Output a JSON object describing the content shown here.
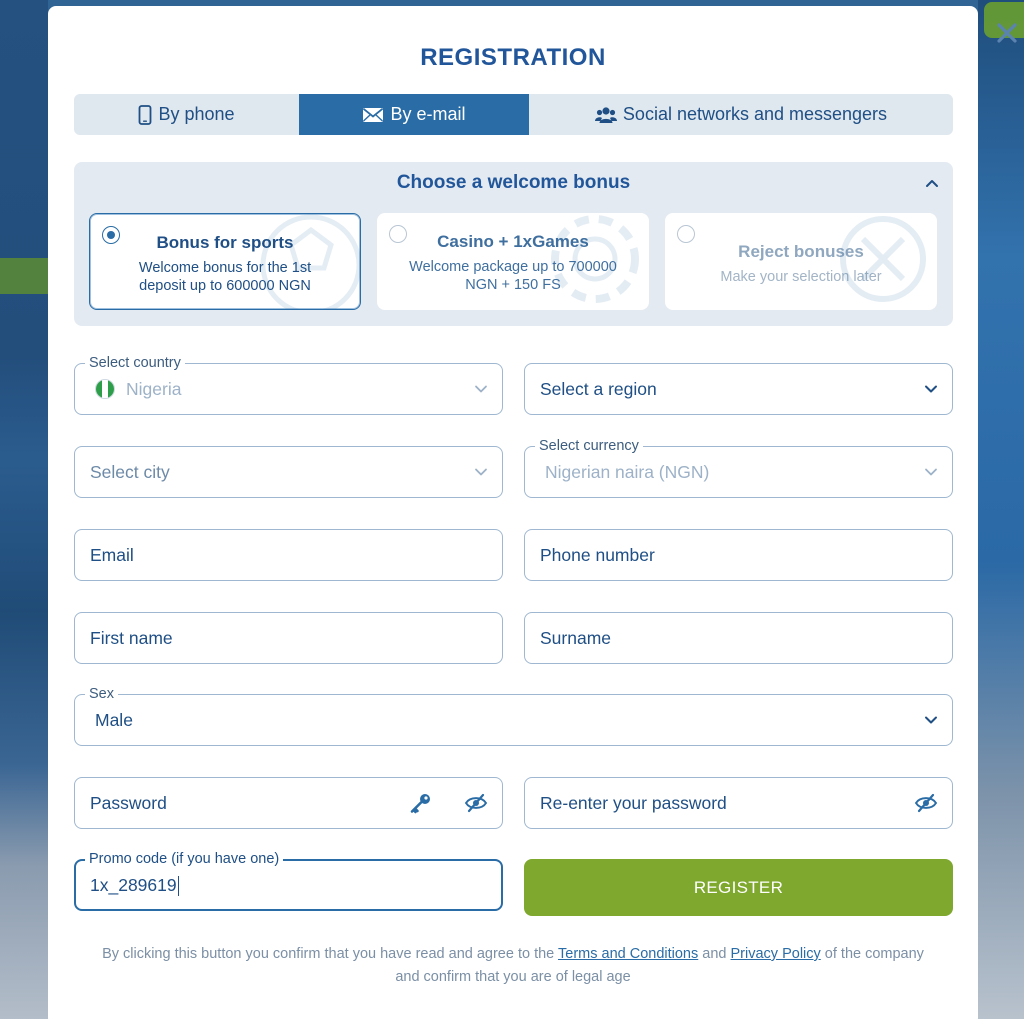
{
  "modal": {
    "title": "REGISTRATION",
    "close_icon": "close-icon"
  },
  "tabs": [
    {
      "label": "By phone",
      "icon": "phone-icon",
      "active": false
    },
    {
      "label": "By e-mail",
      "icon": "envelope-icon",
      "active": true
    },
    {
      "label": "Social networks and messengers",
      "icon": "users-icon",
      "active": false
    }
  ],
  "bonus": {
    "title": "Choose a welcome bonus",
    "cards": [
      {
        "title": "Bonus for sports",
        "desc": "Welcome bonus for the 1st deposit up to 600000 NGN",
        "selected": true
      },
      {
        "title": "Casino + 1xGames",
        "desc": "Welcome package up to 700000 NGN + 150 FS",
        "selected": false
      },
      {
        "title": "Reject bonuses",
        "desc": "Make your selection later",
        "selected": false
      }
    ]
  },
  "form": {
    "country": {
      "label": "Select country",
      "value": "Nigeria"
    },
    "region": {
      "placeholder": "Select a region"
    },
    "city": {
      "placeholder": "Select city"
    },
    "currency": {
      "label": "Select currency",
      "value": "Nigerian naira (NGN)"
    },
    "email": {
      "placeholder": "Email"
    },
    "phone": {
      "placeholder": "Phone number"
    },
    "first_name": {
      "placeholder": "First name"
    },
    "surname": {
      "placeholder": "Surname"
    },
    "sex": {
      "label": "Sex",
      "value": "Male"
    },
    "password": {
      "placeholder": "Password"
    },
    "password_repeat": {
      "placeholder": "Re-enter your password"
    },
    "promo": {
      "label": "Promo code (if you have one)",
      "value": "1x_289619"
    }
  },
  "register_button": "REGISTER",
  "disclaimer": {
    "part1": "By clicking this button you confirm that you have read and agree to the ",
    "terms_link": "Terms and Conditions",
    "part2": " and ",
    "privacy_link": "Privacy Policy",
    "part3": " of the company",
    "part4": "and confirm that you are of legal age"
  },
  "colors": {
    "primary": "#2a6ca5",
    "title": "#22569a",
    "register": "#7ea82e",
    "panel": "#e3eaf1"
  }
}
